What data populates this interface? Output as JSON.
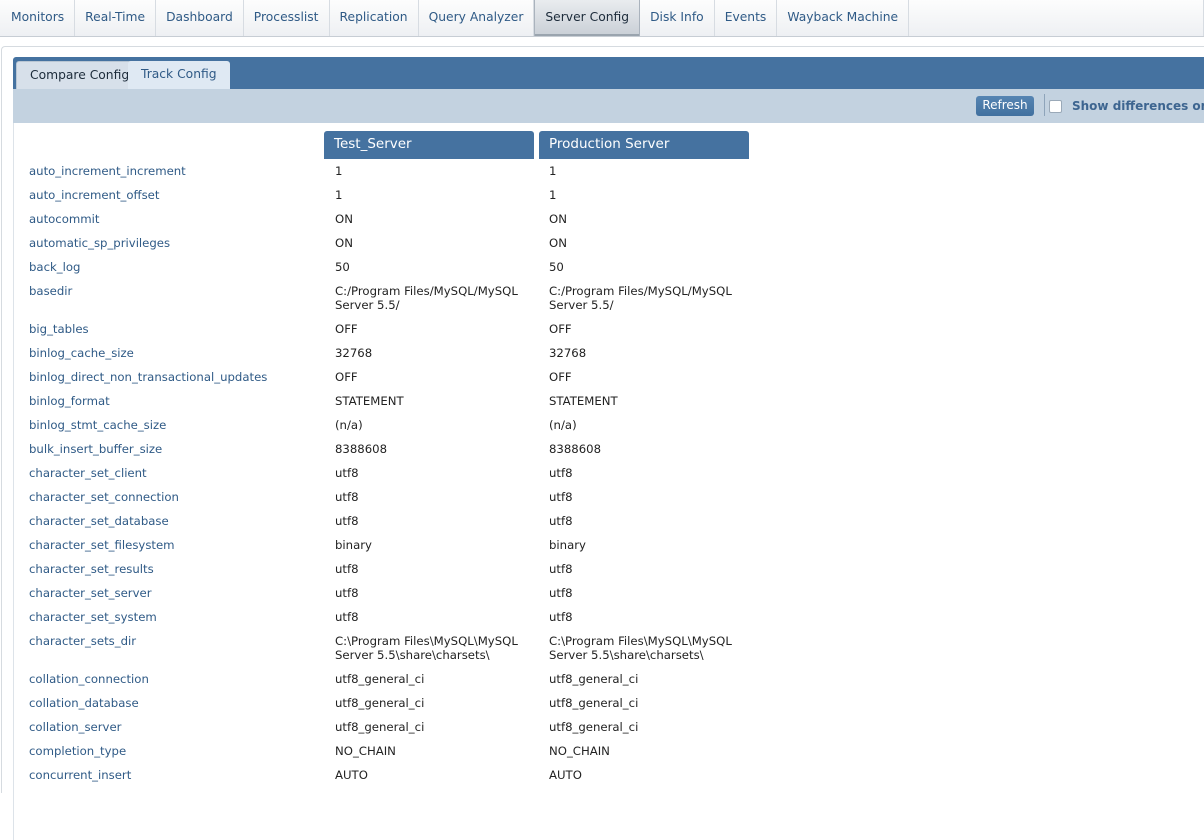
{
  "topnav": {
    "tabs": [
      "Monitors",
      "Real-Time",
      "Dashboard",
      "Processlist",
      "Replication",
      "Query Analyzer",
      "Server Config",
      "Disk Info",
      "Events",
      "Wayback Machine"
    ],
    "active": "Server Config"
  },
  "subtabs": {
    "compare": "Compare Config",
    "track": "Track Config"
  },
  "toolbar": {
    "refresh_label": "Refresh",
    "show_diff_label": "Show differences only",
    "show_diff_checked": false
  },
  "columns": {
    "server1": "Test_Server",
    "server2": "Production Server"
  },
  "rows": [
    {
      "name": "auto_increment_increment",
      "v1": "1",
      "v2": "1"
    },
    {
      "name": "auto_increment_offset",
      "v1": "1",
      "v2": "1"
    },
    {
      "name": "autocommit",
      "v1": "ON",
      "v2": "ON"
    },
    {
      "name": "automatic_sp_privileges",
      "v1": "ON",
      "v2": "ON"
    },
    {
      "name": "back_log",
      "v1": "50",
      "v2": "50"
    },
    {
      "name": "basedir",
      "v1": "C:/Program Files/MySQL/MySQL Server 5.5/",
      "v2": "C:/Program Files/MySQL/MySQL Server 5.5/"
    },
    {
      "name": "big_tables",
      "v1": "OFF",
      "v2": "OFF"
    },
    {
      "name": "binlog_cache_size",
      "v1": "32768",
      "v2": "32768"
    },
    {
      "name": "binlog_direct_non_transactional_updates",
      "v1": "OFF",
      "v2": "OFF"
    },
    {
      "name": "binlog_format",
      "v1": "STATEMENT",
      "v2": "STATEMENT"
    },
    {
      "name": "binlog_stmt_cache_size",
      "v1": "(n/a)",
      "v2": "(n/a)"
    },
    {
      "name": "bulk_insert_buffer_size",
      "v1": "8388608",
      "v2": "8388608"
    },
    {
      "name": "character_set_client",
      "v1": "utf8",
      "v2": "utf8"
    },
    {
      "name": "character_set_connection",
      "v1": "utf8",
      "v2": "utf8"
    },
    {
      "name": "character_set_database",
      "v1": "utf8",
      "v2": "utf8"
    },
    {
      "name": "character_set_filesystem",
      "v1": "binary",
      "v2": "binary"
    },
    {
      "name": "character_set_results",
      "v1": "utf8",
      "v2": "utf8"
    },
    {
      "name": "character_set_server",
      "v1": "utf8",
      "v2": "utf8"
    },
    {
      "name": "character_set_system",
      "v1": "utf8",
      "v2": "utf8"
    },
    {
      "name": "character_sets_dir",
      "v1": "C:\\Program Files\\MySQL\\MySQL Server 5.5\\share\\charsets\\",
      "v2": "C:\\Program Files\\MySQL\\MySQL Server 5.5\\share\\charsets\\"
    },
    {
      "name": "collation_connection",
      "v1": "utf8_general_ci",
      "v2": "utf8_general_ci"
    },
    {
      "name": "collation_database",
      "v1": "utf8_general_ci",
      "v2": "utf8_general_ci"
    },
    {
      "name": "collation_server",
      "v1": "utf8_general_ci",
      "v2": "utf8_general_ci"
    },
    {
      "name": "completion_type",
      "v1": "NO_CHAIN",
      "v2": "NO_CHAIN"
    },
    {
      "name": "concurrent_insert",
      "v1": "AUTO",
      "v2": "AUTO"
    }
  ]
}
